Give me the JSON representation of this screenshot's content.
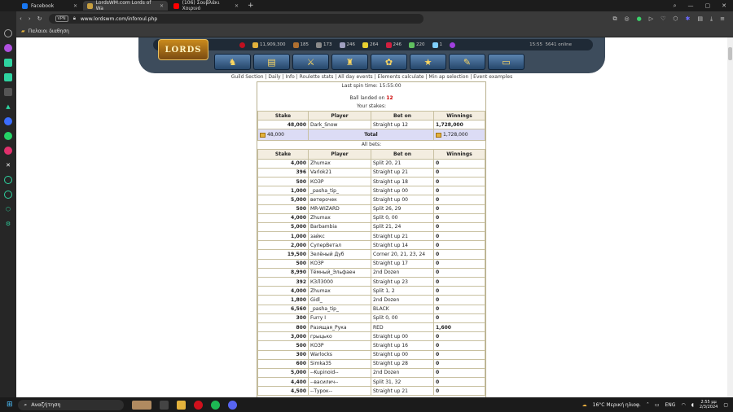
{
  "browser": {
    "tabs": [
      {
        "label": "Facebook",
        "color": "#1877f2"
      },
      {
        "label": "LordsWM.com Lords of Wa",
        "color": "#c8a040"
      },
      {
        "label": "(106) Σουβλάκι Χοιρινό",
        "color": "#ff0000"
      }
    ],
    "url": "www.lordswm.com/inforoul.php",
    "vpn_label": "VPN",
    "bookmark_folder": "Παλαιοι διαθηση"
  },
  "game_header": {
    "logo": "LORDS",
    "resources": [
      {
        "icon": "gold-icon",
        "value": "11,909,300",
        "color": "#e3b23c"
      },
      {
        "icon": "wood-icon",
        "value": "185",
        "color": "#b07030"
      },
      {
        "icon": "ore-icon",
        "value": "173",
        "color": "#8a8a8a"
      },
      {
        "icon": "mercury-icon",
        "value": "246",
        "color": "#a0a0c0"
      },
      {
        "icon": "sulfur-icon",
        "value": "264",
        "color": "#e8d030"
      },
      {
        "icon": "crystal-icon",
        "value": "246",
        "color": "#d02040"
      },
      {
        "icon": "gem-icon",
        "value": "220",
        "color": "#60c060"
      },
      {
        "icon": "diamond-icon",
        "value": "1",
        "color": "#80d0ff"
      }
    ],
    "time": "15:55",
    "online": "5641 online"
  },
  "submenu": [
    "Guild Section",
    "Daily",
    "Info",
    "Roulette stats",
    "All day events",
    "Elements calculate",
    "Min ap selection",
    "Event examples"
  ],
  "roulette": {
    "last_spin_label": "Last spin time: 15:55:00",
    "ball_label": "Ball landed on",
    "ball_number": "12",
    "your_stakes_label": "Your stakes:",
    "all_bets_label": "All bets:",
    "columns": [
      "Stake",
      "Player",
      "Bet on",
      "Winnings"
    ],
    "my_stakes": [
      {
        "stake": "48,000",
        "player": "Dark_Snow",
        "bet": "Straight up 12",
        "win": "1,728,000"
      }
    ],
    "total": {
      "stake": "48,000",
      "label": "Total",
      "win": "1,728,000"
    },
    "all_bets": [
      {
        "stake": "4,000",
        "player": "Zhumax",
        "bet": "Split 20, 21",
        "win": "0"
      },
      {
        "stake": "396",
        "player": "Varlok21",
        "bet": "Straight up 21",
        "win": "0"
      },
      {
        "stake": "500",
        "player": "КОЗР",
        "bet": "Straight up 18",
        "win": "0"
      },
      {
        "stake": "1,000",
        "player": "_pasha_tip_",
        "bet": "Straight up 00",
        "win": "0"
      },
      {
        "stake": "5,000",
        "player": "ветерочек",
        "bet": "Straight up 00",
        "win": "0"
      },
      {
        "stake": "500",
        "player": "MR-WIZARD",
        "bet": "Split 26, 29",
        "win": "0"
      },
      {
        "stake": "4,000",
        "player": "Zhumax",
        "bet": "Split 0, 00",
        "win": "0"
      },
      {
        "stake": "5,000",
        "player": "Barbambia",
        "bet": "Split 21, 24",
        "win": "0"
      },
      {
        "stake": "1,000",
        "player": "зайкс",
        "bet": "Straight up 21",
        "win": "0"
      },
      {
        "stake": "2,000",
        "player": "СуперВетал",
        "bet": "Straight up 14",
        "win": "0"
      },
      {
        "stake": "19,500",
        "player": "Зелёный Дуб",
        "bet": "Corner 20, 21, 23, 24",
        "win": "0"
      },
      {
        "stake": "500",
        "player": "КОЗР",
        "bet": "Straight up 17",
        "win": "0"
      },
      {
        "stake": "8,990",
        "player": "Тёмный_Эльфаен",
        "bet": "2nd Dozen",
        "win": "0"
      },
      {
        "stake": "392",
        "player": "КЗЛ3000",
        "bet": "Straight up 23",
        "win": "0"
      },
      {
        "stake": "4,000",
        "player": "Zhumax",
        "bet": "Split 1, 2",
        "win": "0"
      },
      {
        "stake": "1,800",
        "player": "Gidl_",
        "bet": "2nd Dozen",
        "win": "0"
      },
      {
        "stake": "6,560",
        "player": "_pasha_tip_",
        "bet": "BLACK",
        "win": "0"
      },
      {
        "stake": "300",
        "player": "Furry I",
        "bet": "Split 0, 00",
        "win": "0"
      },
      {
        "stake": "800",
        "player": "Разящая_Рука",
        "bet": "RED",
        "win": "1,600"
      },
      {
        "stake": "3,000",
        "player": "грыцько",
        "bet": "Straight up 00",
        "win": "0"
      },
      {
        "stake": "500",
        "player": "КОЗР",
        "bet": "Straight up 16",
        "win": "0"
      },
      {
        "stake": "300",
        "player": "Warlocks",
        "bet": "Straight up 00",
        "win": "0"
      },
      {
        "stake": "600",
        "player": "Simka35",
        "bet": "Straight up 28",
        "win": "0"
      },
      {
        "stake": "5,000",
        "player": "--Kupinoid--",
        "bet": "2nd Dozen",
        "win": "0"
      },
      {
        "stake": "4,400",
        "player": "--василич--",
        "bet": "Split 31, 32",
        "win": "0"
      },
      {
        "stake": "4,500",
        "player": "--Турок--",
        "bet": "Straight up 21",
        "win": "0"
      }
    ]
  },
  "taskbar": {
    "search_placeholder": "Αναζήτηση",
    "weather": "16°C Μερική ηλιοφ.",
    "lang": "ENG",
    "time": "2:55 μμ",
    "date": "2/3/2024"
  }
}
